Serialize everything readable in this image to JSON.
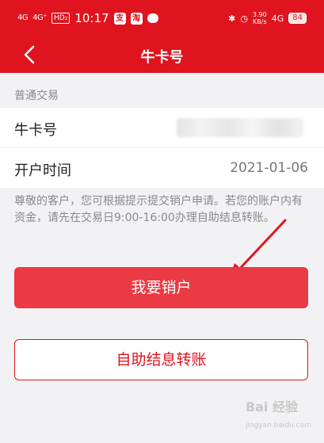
{
  "status_bar": {
    "signal_1": "4G",
    "signal_2": "4G⁺",
    "hd": "HD₂",
    "time": "10:17",
    "app_icon_1": "支",
    "app_icon_2": "淘",
    "speed_value": "3.90",
    "speed_unit": "KB/s",
    "network": "4G",
    "battery": "84"
  },
  "nav": {
    "title": "牛卡号"
  },
  "section": {
    "header": "普通交易"
  },
  "rows": [
    {
      "label": "牛卡号",
      "value": ""
    },
    {
      "label": "开户时间",
      "value": "2021-01-06"
    }
  ],
  "notice": "尊敬的客户，您可根据提示提交销户申请。若您的账户内有资金，请先在交易日9:00-16:00办理自助结息转账。",
  "buttons": {
    "primary": "我要销户",
    "secondary": "自助结息转账"
  },
  "watermark": {
    "brand": "Bai 经验",
    "url": "jingyan.baidu.com"
  },
  "colors": {
    "brand_red": "#e0141e",
    "button_red": "#ea3a43"
  }
}
